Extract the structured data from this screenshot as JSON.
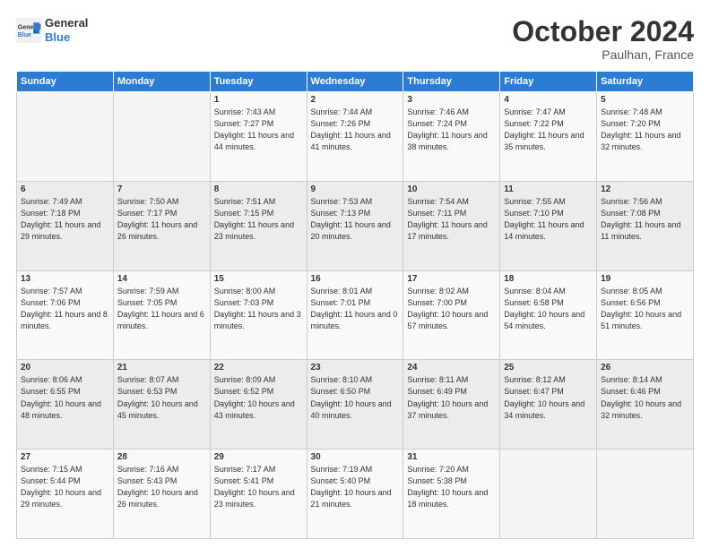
{
  "header": {
    "logo_line1": "General",
    "logo_line2": "Blue",
    "month": "October 2024",
    "location": "Paulhan, France"
  },
  "days_of_week": [
    "Sunday",
    "Monday",
    "Tuesday",
    "Wednesday",
    "Thursday",
    "Friday",
    "Saturday"
  ],
  "weeks": [
    [
      {
        "day": "",
        "sunrise": "",
        "sunset": "",
        "daylight": ""
      },
      {
        "day": "",
        "sunrise": "",
        "sunset": "",
        "daylight": ""
      },
      {
        "day": "1",
        "sunrise": "Sunrise: 7:43 AM",
        "sunset": "Sunset: 7:27 PM",
        "daylight": "Daylight: 11 hours and 44 minutes."
      },
      {
        "day": "2",
        "sunrise": "Sunrise: 7:44 AM",
        "sunset": "Sunset: 7:26 PM",
        "daylight": "Daylight: 11 hours and 41 minutes."
      },
      {
        "day": "3",
        "sunrise": "Sunrise: 7:46 AM",
        "sunset": "Sunset: 7:24 PM",
        "daylight": "Daylight: 11 hours and 38 minutes."
      },
      {
        "day": "4",
        "sunrise": "Sunrise: 7:47 AM",
        "sunset": "Sunset: 7:22 PM",
        "daylight": "Daylight: 11 hours and 35 minutes."
      },
      {
        "day": "5",
        "sunrise": "Sunrise: 7:48 AM",
        "sunset": "Sunset: 7:20 PM",
        "daylight": "Daylight: 11 hours and 32 minutes."
      }
    ],
    [
      {
        "day": "6",
        "sunrise": "Sunrise: 7:49 AM",
        "sunset": "Sunset: 7:18 PM",
        "daylight": "Daylight: 11 hours and 29 minutes."
      },
      {
        "day": "7",
        "sunrise": "Sunrise: 7:50 AM",
        "sunset": "Sunset: 7:17 PM",
        "daylight": "Daylight: 11 hours and 26 minutes."
      },
      {
        "day": "8",
        "sunrise": "Sunrise: 7:51 AM",
        "sunset": "Sunset: 7:15 PM",
        "daylight": "Daylight: 11 hours and 23 minutes."
      },
      {
        "day": "9",
        "sunrise": "Sunrise: 7:53 AM",
        "sunset": "Sunset: 7:13 PM",
        "daylight": "Daylight: 11 hours and 20 minutes."
      },
      {
        "day": "10",
        "sunrise": "Sunrise: 7:54 AM",
        "sunset": "Sunset: 7:11 PM",
        "daylight": "Daylight: 11 hours and 17 minutes."
      },
      {
        "day": "11",
        "sunrise": "Sunrise: 7:55 AM",
        "sunset": "Sunset: 7:10 PM",
        "daylight": "Daylight: 11 hours and 14 minutes."
      },
      {
        "day": "12",
        "sunrise": "Sunrise: 7:56 AM",
        "sunset": "Sunset: 7:08 PM",
        "daylight": "Daylight: 11 hours and 11 minutes."
      }
    ],
    [
      {
        "day": "13",
        "sunrise": "Sunrise: 7:57 AM",
        "sunset": "Sunset: 7:06 PM",
        "daylight": "Daylight: 11 hours and 8 minutes."
      },
      {
        "day": "14",
        "sunrise": "Sunrise: 7:59 AM",
        "sunset": "Sunset: 7:05 PM",
        "daylight": "Daylight: 11 hours and 6 minutes."
      },
      {
        "day": "15",
        "sunrise": "Sunrise: 8:00 AM",
        "sunset": "Sunset: 7:03 PM",
        "daylight": "Daylight: 11 hours and 3 minutes."
      },
      {
        "day": "16",
        "sunrise": "Sunrise: 8:01 AM",
        "sunset": "Sunset: 7:01 PM",
        "daylight": "Daylight: 11 hours and 0 minutes."
      },
      {
        "day": "17",
        "sunrise": "Sunrise: 8:02 AM",
        "sunset": "Sunset: 7:00 PM",
        "daylight": "Daylight: 10 hours and 57 minutes."
      },
      {
        "day": "18",
        "sunrise": "Sunrise: 8:04 AM",
        "sunset": "Sunset: 6:58 PM",
        "daylight": "Daylight: 10 hours and 54 minutes."
      },
      {
        "day": "19",
        "sunrise": "Sunrise: 8:05 AM",
        "sunset": "Sunset: 6:56 PM",
        "daylight": "Daylight: 10 hours and 51 minutes."
      }
    ],
    [
      {
        "day": "20",
        "sunrise": "Sunrise: 8:06 AM",
        "sunset": "Sunset: 6:55 PM",
        "daylight": "Daylight: 10 hours and 48 minutes."
      },
      {
        "day": "21",
        "sunrise": "Sunrise: 8:07 AM",
        "sunset": "Sunset: 6:53 PM",
        "daylight": "Daylight: 10 hours and 45 minutes."
      },
      {
        "day": "22",
        "sunrise": "Sunrise: 8:09 AM",
        "sunset": "Sunset: 6:52 PM",
        "daylight": "Daylight: 10 hours and 43 minutes."
      },
      {
        "day": "23",
        "sunrise": "Sunrise: 8:10 AM",
        "sunset": "Sunset: 6:50 PM",
        "daylight": "Daylight: 10 hours and 40 minutes."
      },
      {
        "day": "24",
        "sunrise": "Sunrise: 8:11 AM",
        "sunset": "Sunset: 6:49 PM",
        "daylight": "Daylight: 10 hours and 37 minutes."
      },
      {
        "day": "25",
        "sunrise": "Sunrise: 8:12 AM",
        "sunset": "Sunset: 6:47 PM",
        "daylight": "Daylight: 10 hours and 34 minutes."
      },
      {
        "day": "26",
        "sunrise": "Sunrise: 8:14 AM",
        "sunset": "Sunset: 6:46 PM",
        "daylight": "Daylight: 10 hours and 32 minutes."
      }
    ],
    [
      {
        "day": "27",
        "sunrise": "Sunrise: 7:15 AM",
        "sunset": "Sunset: 5:44 PM",
        "daylight": "Daylight: 10 hours and 29 minutes."
      },
      {
        "day": "28",
        "sunrise": "Sunrise: 7:16 AM",
        "sunset": "Sunset: 5:43 PM",
        "daylight": "Daylight: 10 hours and 26 minutes."
      },
      {
        "day": "29",
        "sunrise": "Sunrise: 7:17 AM",
        "sunset": "Sunset: 5:41 PM",
        "daylight": "Daylight: 10 hours and 23 minutes."
      },
      {
        "day": "30",
        "sunrise": "Sunrise: 7:19 AM",
        "sunset": "Sunset: 5:40 PM",
        "daylight": "Daylight: 10 hours and 21 minutes."
      },
      {
        "day": "31",
        "sunrise": "Sunrise: 7:20 AM",
        "sunset": "Sunset: 5:38 PM",
        "daylight": "Daylight: 10 hours and 18 minutes."
      },
      {
        "day": "",
        "sunrise": "",
        "sunset": "",
        "daylight": ""
      },
      {
        "day": "",
        "sunrise": "",
        "sunset": "",
        "daylight": ""
      }
    ]
  ]
}
